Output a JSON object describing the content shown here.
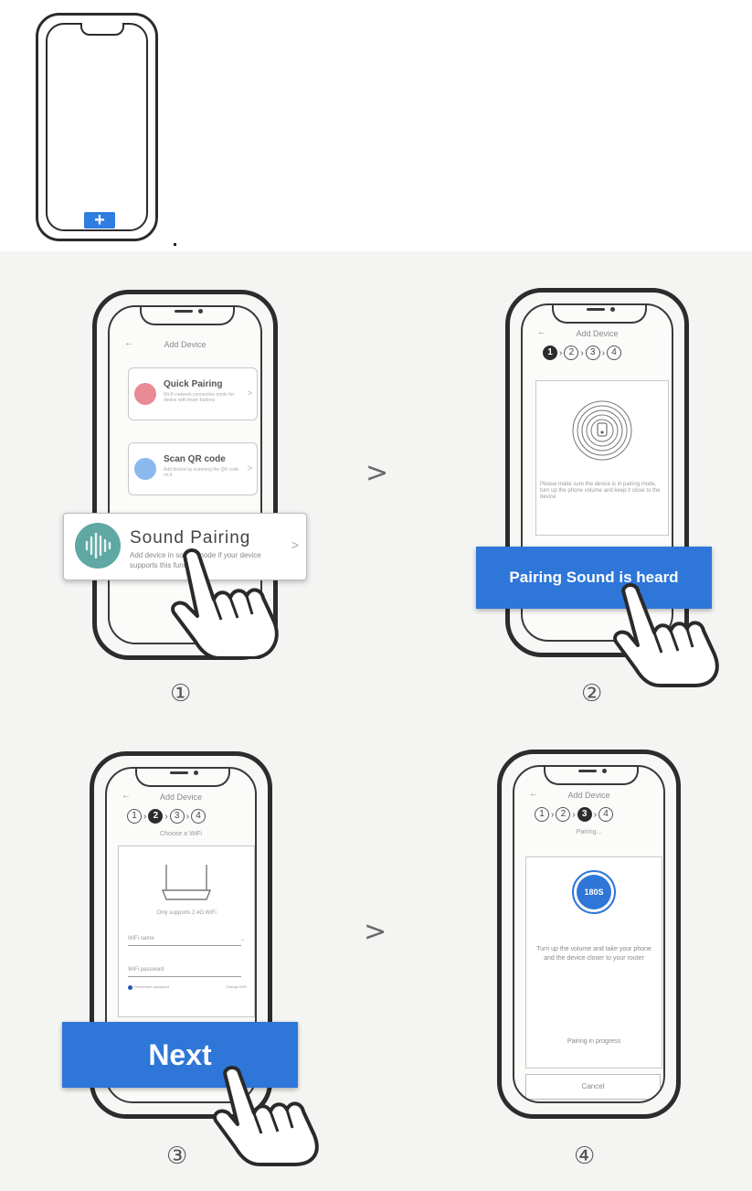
{
  "top": {
    "plus_glyph": "+"
  },
  "step1": {
    "header": "Add Device",
    "back": "←",
    "quick_pairing": {
      "title": "Quick Pairing",
      "desc": "Wi-Fi network connection mode for device with fewer buttons"
    },
    "scan_qr": {
      "title": "Scan QR code",
      "desc": "Add device by scanning the QR code on it"
    },
    "sound_pairing": {
      "title": "Sound Pairing",
      "desc": "Add device in sound mode if your device supports this function"
    },
    "chevron": ">",
    "number": "①"
  },
  "step2": {
    "header": "Add Device",
    "back": "←",
    "steps": [
      "1",
      "2",
      "3",
      "4"
    ],
    "active_step": 1,
    "desc": "Please make sure the device is in pairing mode, turn up the phone volume and keep it close to the device",
    "button": "Pairing Sound is heard",
    "number": "②"
  },
  "step3": {
    "header": "Add Device",
    "back": "←",
    "steps": [
      "1",
      "2",
      "3",
      "4"
    ],
    "active_step": 2,
    "subtitle": "Choose a WiFi",
    "support_note": "Only supports 2.4G WiFi",
    "wifi_name": "WiFi name",
    "wifi_password": "WiFi password",
    "remember": "Remember password",
    "change": "Change WiFi",
    "button": "Next",
    "number": "③"
  },
  "step4": {
    "header": "Add Device",
    "back": "←",
    "steps": [
      "1",
      "2",
      "3",
      "4"
    ],
    "active_step": 3,
    "subtitle": "Pairing...",
    "timer": "180S",
    "instructions": "Turn up the volume and take your phone and the device closer to your router",
    "progress": "Pairing in progress",
    "cancel": "Cancel",
    "number": "④"
  },
  "arrows": {
    "glyph": ">"
  },
  "colors": {
    "accent_blue": "#2e76d8",
    "outline": "#2c2c2c"
  }
}
